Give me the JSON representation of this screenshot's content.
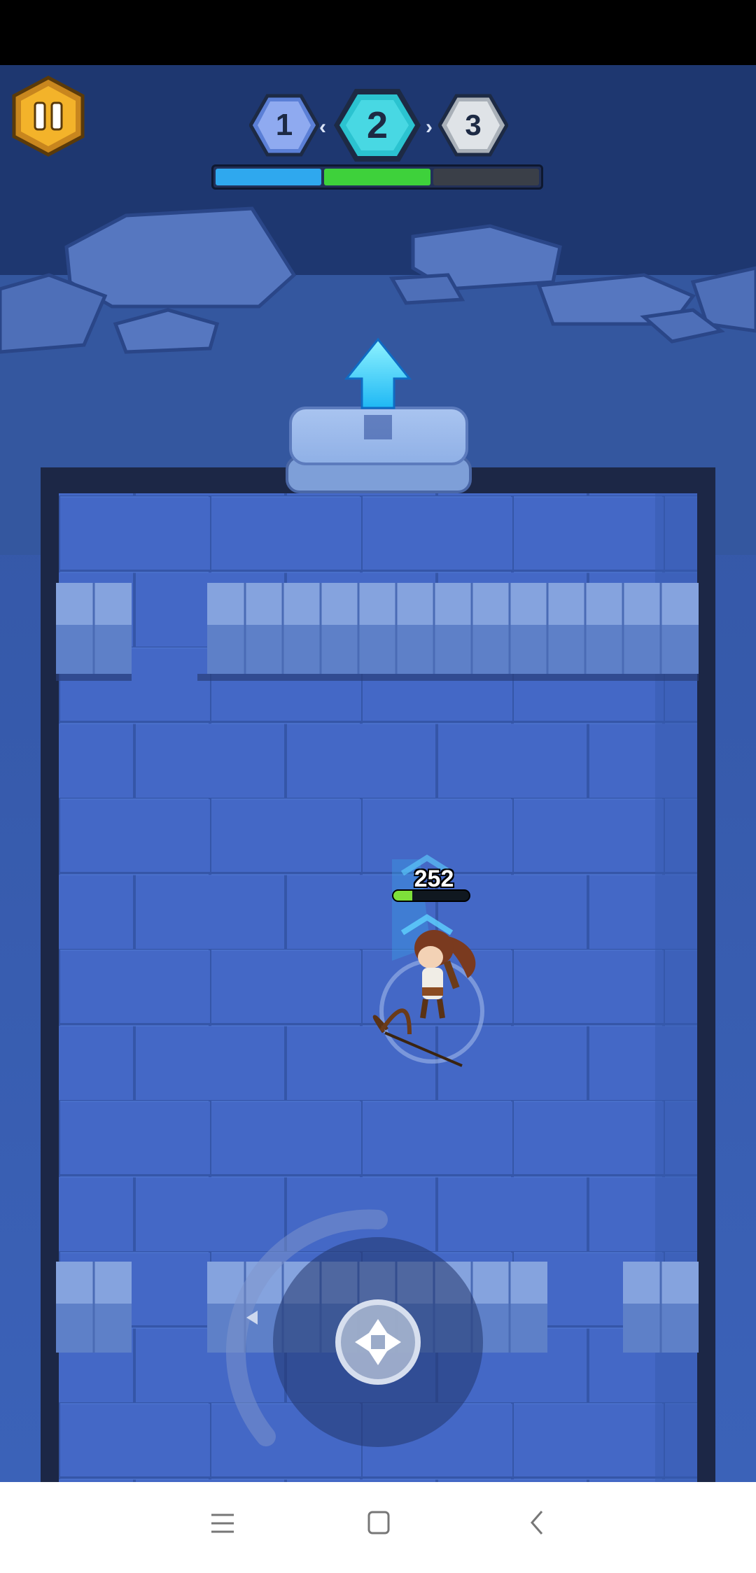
{
  "hud": {
    "stages": [
      {
        "label": "1",
        "state": "completed",
        "color": "#5b7fd6"
      },
      {
        "label": "2",
        "state": "current",
        "color": "#2bc3d0"
      },
      {
        "label": "3",
        "state": "locked",
        "color": "#a9b0b8"
      }
    ],
    "progress_colors": [
      "#2fa8ee",
      "#3ed13b",
      "#3a3f48"
    ],
    "pause_icon": "pause-icon"
  },
  "player": {
    "hp": "252",
    "hp_fraction": 0.25
  },
  "controls": {
    "joystick_icon": "dpad-icon"
  },
  "nav": {
    "menu_icon": "menu-icon",
    "home_icon": "square-icon",
    "back_icon": "back-chevron-icon"
  }
}
